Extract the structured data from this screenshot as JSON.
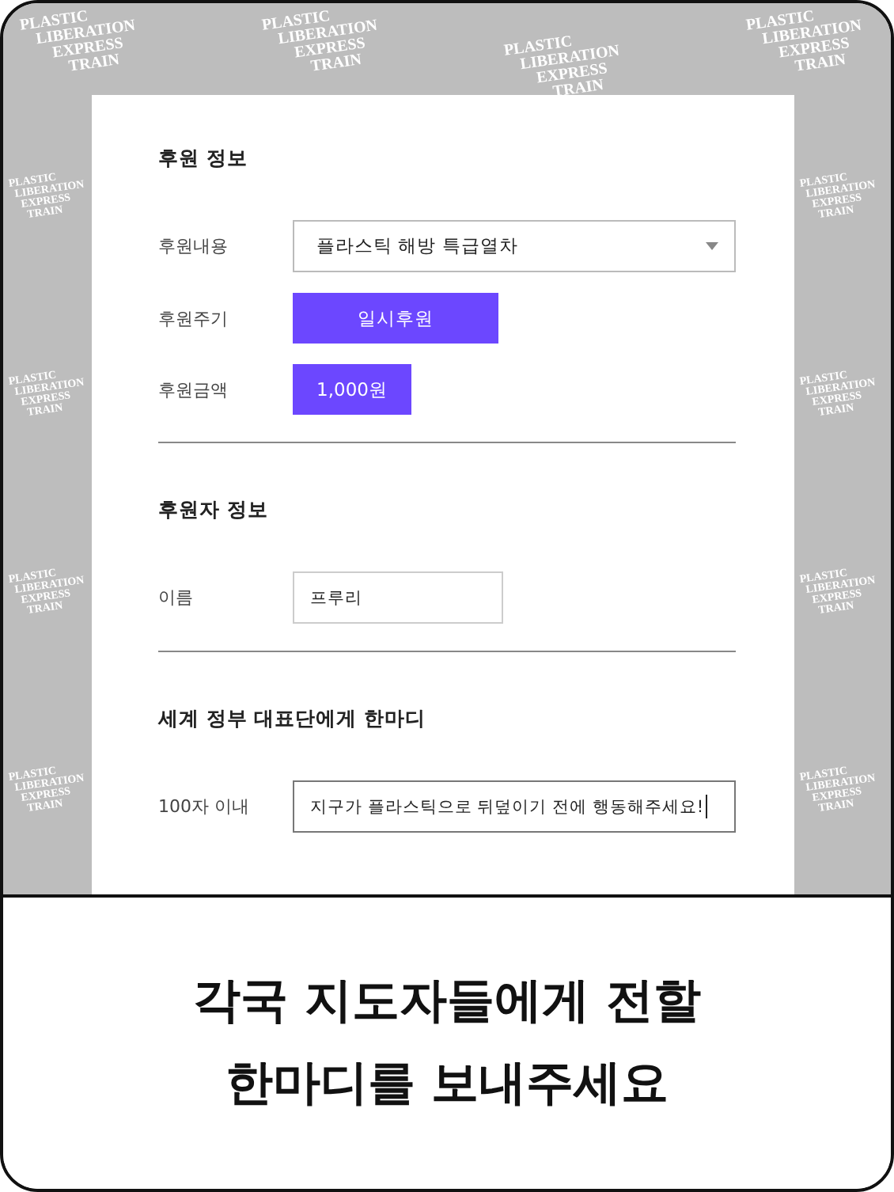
{
  "background_tiles": [
    {
      "lines": [
        "PLASTIC",
        "LIBERATION",
        "EXPRESS",
        "TRAIN"
      ]
    },
    {
      "lines": [
        "PLASTIC",
        "LIBERATION",
        "EXPRESS",
        "TRAIN"
      ]
    },
    {
      "lines": [
        "PLASTIC",
        "LIBERATION",
        "EXPRESS",
        "TRAIN"
      ]
    },
    {
      "lines": [
        "PLASTIC",
        "LIBERATION",
        "EXPRESS",
        "TRAIN"
      ]
    },
    {
      "lines": [
        "PLASTIC",
        "LIBERATION",
        "EXPRESS",
        "TRAIN"
      ]
    },
    {
      "lines": [
        "PLASTIC",
        "LIBERATION",
        "EXPRESS",
        "TRAIN"
      ]
    },
    {
      "lines": [
        "PLASTIC",
        "LIBERATION",
        "EXPRESS",
        "TRAIN"
      ]
    },
    {
      "lines": [
        "PLASTIC",
        "LIBERATION",
        "EXPRESS",
        "TRAIN"
      ]
    },
    {
      "lines": [
        "PLASTIC",
        "LIBERATION",
        "EXPRESS",
        "TRAIN"
      ]
    },
    {
      "lines": [
        "PLASTIC",
        "LIBERATION",
        "EXPRESS",
        "TRAIN"
      ]
    },
    {
      "lines": [
        "PLASTIC",
        "LIBERATION",
        "EXPRESS",
        "TRAIN"
      ]
    },
    {
      "lines": [
        "PLASTIC",
        "LIBERATION",
        "EXPRESS",
        "TRAIN"
      ]
    }
  ],
  "sections": [
    {
      "title": "후원 정보",
      "rows": [
        {
          "kind": "select",
          "label": "후원내용",
          "value": "플라스틱 해방 특급열차"
        },
        {
          "kind": "option",
          "label": "후원주기",
          "value": "일시후원",
          "selected": true,
          "wide": true
        },
        {
          "kind": "option",
          "label": "후원금액",
          "value": "1,000원",
          "selected": true,
          "wide": false
        }
      ]
    },
    {
      "title": "후원자 정보",
      "rows": [
        {
          "kind": "input",
          "label": "이름",
          "value": "프루리",
          "focused": false,
          "wide": false
        }
      ]
    },
    {
      "title": "세계 정부 대표단에게 한마디",
      "rows": [
        {
          "kind": "input",
          "label": "100자 이내",
          "value": "지구가 플라스틱으로 뒤덮이기 전에 행동해주세요!",
          "focused": true,
          "wide": true
        }
      ]
    }
  ],
  "caption": {
    "lines": [
      "각국 지도자들에게 전할",
      "한마디를 보내주세요"
    ]
  }
}
